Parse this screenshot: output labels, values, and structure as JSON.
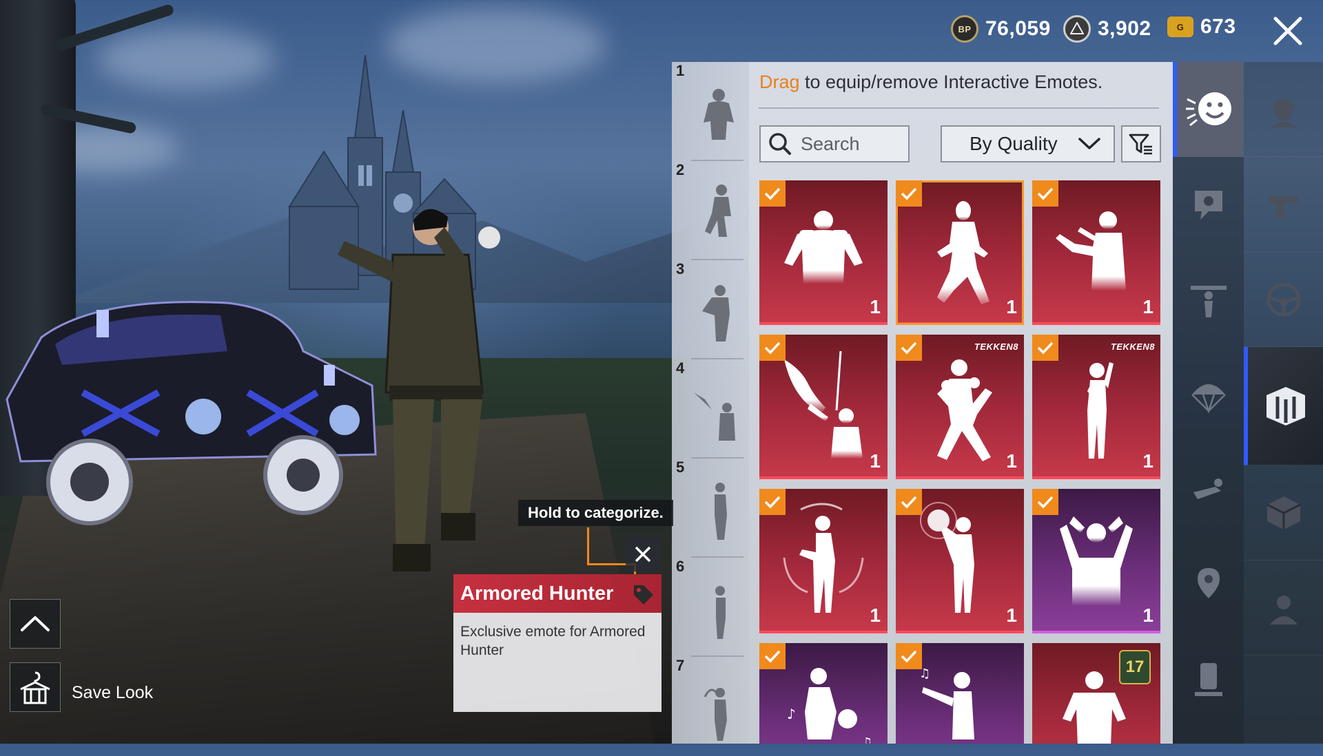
{
  "currency": {
    "bp": {
      "icon": "bp-coin-icon",
      "icon_text": "BP",
      "value": "76,059"
    },
    "ag": {
      "icon": "ag-coin-icon",
      "value": "3,902"
    },
    "uc": {
      "icon": "g-coin-icon",
      "icon_text": "G",
      "value": "673"
    }
  },
  "slots": [
    {
      "number": "1"
    },
    {
      "number": "2"
    },
    {
      "number": "3"
    },
    {
      "number": "4"
    },
    {
      "number": "5"
    },
    {
      "number": "6"
    },
    {
      "number": "7"
    }
  ],
  "panel": {
    "hint_accent": "Drag",
    "hint_rest": " to equip/remove Interactive Emotes.",
    "search_placeholder": "Search",
    "sort_label": "By Quality"
  },
  "emotes": [
    {
      "count": "1",
      "quality": "red",
      "checked": true,
      "icon": "armored-hunter-emote-icon"
    },
    {
      "count": "1",
      "quality": "red",
      "checked": true,
      "icon": "dance-emote-icon",
      "selected": true
    },
    {
      "count": "1",
      "quality": "red",
      "checked": true,
      "icon": "point-emote-icon"
    },
    {
      "count": "1",
      "quality": "red",
      "checked": true,
      "icon": "eagle-emote-icon"
    },
    {
      "count": "1",
      "quality": "red",
      "checked": true,
      "icon": "fight-stance-emote-icon",
      "badge": "TEKKEN8"
    },
    {
      "count": "1",
      "quality": "red",
      "checked": true,
      "icon": "fighter-pose-emote-icon",
      "badge": "TEKKEN8"
    },
    {
      "count": "1",
      "quality": "red",
      "checked": true,
      "icon": "spin-emote-icon"
    },
    {
      "count": "1",
      "quality": "red",
      "checked": true,
      "icon": "energy-orb-emote-icon"
    },
    {
      "count": "1",
      "quality": "purple",
      "checked": true,
      "icon": "hands-on-head-emote-icon"
    },
    {
      "count": "",
      "quality": "purple",
      "checked": true,
      "icon": "basketball-emote-icon"
    },
    {
      "count": "",
      "quality": "purple",
      "checked": true,
      "icon": "music-point-emote-icon"
    },
    {
      "count": "",
      "quality": "red",
      "checked": false,
      "icon": "flex-emote-icon",
      "level": "17"
    }
  ],
  "tooltip": {
    "hint": "Hold to categorize.",
    "title": "Armored Hunter",
    "description": "Exclusive emote for Armored Hunter"
  },
  "buttons": {
    "save_look": "Save Look"
  },
  "colors": {
    "accent_orange": "#f08a1c",
    "quality_red": "#c6394a",
    "quality_purple": "#8a3e98",
    "active_tab_blue": "#2f5bff"
  }
}
